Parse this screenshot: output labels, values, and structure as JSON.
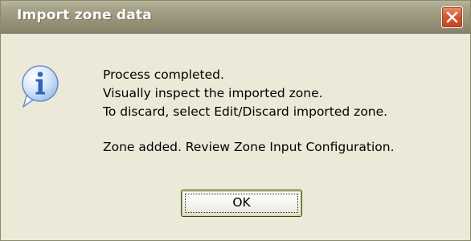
{
  "dialog": {
    "title": "Import zone data",
    "message_lines": [
      "Process completed.",
      "Visually inspect the imported zone.",
      "To discard, select Edit/Discard imported zone.",
      "Zone added. Review Zone Input Configuration."
    ],
    "ok_label": "OK",
    "icon": "info-icon",
    "close_icon": "close-icon"
  },
  "colors": {
    "titlebar": "#9a977c",
    "window_background": "#ece9d8",
    "close_button": "#d6582f",
    "info_icon": "#2f64c8"
  }
}
